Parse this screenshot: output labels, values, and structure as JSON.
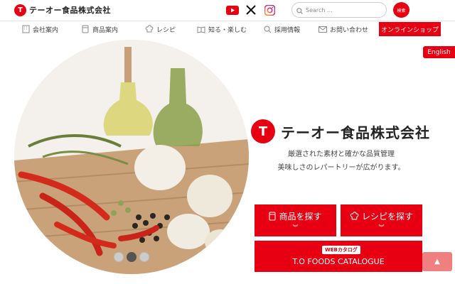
{
  "header": {
    "logo_mark": "T",
    "logo_text": "テーオー食品株式会社",
    "search_placeholder": "Search ...",
    "search_button": "検索"
  },
  "icons": {
    "youtube": "youtube-icon",
    "x": "x-icon",
    "instagram": "instagram-icon"
  },
  "nav": {
    "items": [
      {
        "label": "会社案内",
        "icon": "building-icon"
      },
      {
        "label": "商品案内",
        "icon": "product-icon"
      },
      {
        "label": "レシピ",
        "icon": "chef-hat-icon"
      },
      {
        "label": "知る・楽しむ",
        "icon": "book-icon"
      },
      {
        "label": "採用情報",
        "icon": "magnifier-icon"
      },
      {
        "label": "お問い合わせ",
        "icon": "mail-icon"
      }
    ],
    "online_shop": "オンラインショップ"
  },
  "language_button": "English",
  "brand": {
    "mark": "T",
    "name": "テーオー食品株式会社",
    "tagline_1": "厳選された素材と確かな品質管理",
    "tagline_2": "美味しさのレパートリーが広がります。"
  },
  "cta": {
    "products": "商品を探す",
    "recipes": "レシピを探す",
    "chevron": "︾",
    "catalogue_badge": "WEBカタログ",
    "catalogue_title": "T.O FOODS CATALOGUE"
  },
  "back_to_top": "▲",
  "colors": {
    "brand_red": "#e60012",
    "to_top": "#f08080"
  }
}
